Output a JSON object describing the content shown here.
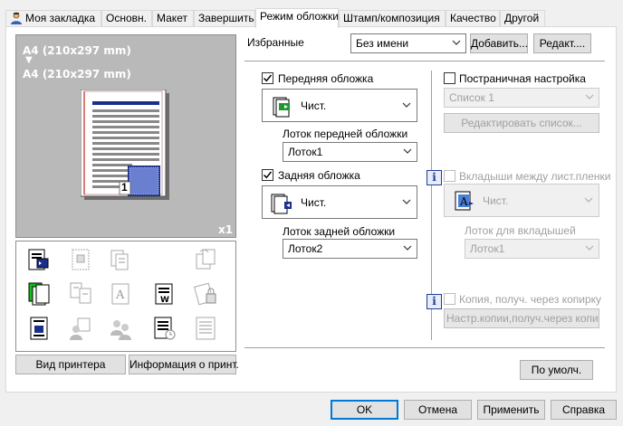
{
  "tabs": [
    {
      "label": "Моя закладка",
      "active": false
    },
    {
      "label": "Основн.",
      "active": false
    },
    {
      "label": "Макет",
      "active": false
    },
    {
      "label": "Завершить",
      "active": false
    },
    {
      "label": "Режим обложки",
      "active": true
    },
    {
      "label": "Штамп/композиция",
      "active": false
    },
    {
      "label": "Качество",
      "active": false
    },
    {
      "label": "Другой",
      "active": false
    }
  ],
  "preview": {
    "paper_from": "A4 (210x297 mm)",
    "arrow": "▼",
    "paper_to": "A4 (210x297 mm)",
    "copies": "x1",
    "page_number": "1"
  },
  "left_buttons": {
    "printer_view": "Вид принтера",
    "printer_info": "Информация о принт."
  },
  "favorites": {
    "label": "Избранные",
    "value": "Без имени",
    "add": "Добавить...",
    "edit": "Редакт...."
  },
  "front_cover": {
    "label": "Передняя обложка",
    "checked": true,
    "type": "Чист.",
    "tray_label": "Лоток передней обложки",
    "tray_value": "Лоток1"
  },
  "back_cover": {
    "label": "Задняя обложка",
    "checked": true,
    "type": "Чист.",
    "tray_label": "Лоток задней обложки",
    "tray_value": "Лоток2"
  },
  "per_page": {
    "label": "Постраничная настройка",
    "checked": false,
    "list_value": "Список 1",
    "edit_list": "Редактировать список..."
  },
  "transparency": {
    "label": "Вкладыши между лист.пленки",
    "checked": false,
    "type": "Чист.",
    "tray_label": "Лоток для вкладышей",
    "tray_value": "Лоток1"
  },
  "carbon": {
    "label": "Копия, получ. через копирку",
    "checked": false,
    "settings": "Настр.копии,получ.через копирку"
  },
  "defaults_button": "По умолч.",
  "dialog_buttons": {
    "ok": "OK",
    "cancel": "Отмена",
    "apply": "Применить",
    "help": "Справка"
  },
  "colors": {
    "accent": "#0078d7",
    "preview_bg": "#b9b9b9",
    "info_blue": "#1d3f94"
  }
}
